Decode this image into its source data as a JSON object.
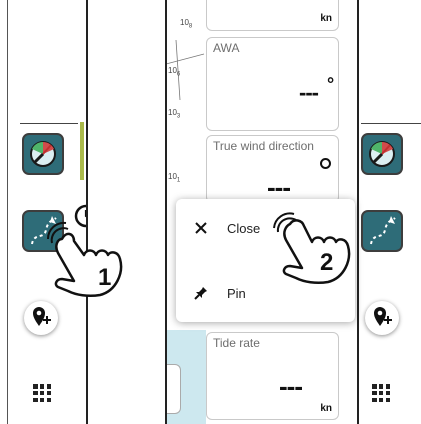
{
  "map_scale": [
    "10",
    "8",
    "10",
    "6",
    "10",
    "3",
    "10",
    "1"
  ],
  "cards": [
    {
      "label": "",
      "value": "",
      "unit": "kn"
    },
    {
      "label": "AWA",
      "value": "---",
      "unit": "°"
    },
    {
      "label": "True wind direction",
      "value": "---",
      "unit": ""
    },
    {
      "label": "Tide rate",
      "value": "---",
      "unit": "kn"
    }
  ],
  "context_menu": {
    "items": [
      {
        "label": "Close",
        "icon": "close-icon"
      },
      {
        "label": "Pin",
        "icon": "pin-icon"
      }
    ]
  },
  "gestures": [
    {
      "step": "1",
      "action": "long-press-timer-icon"
    },
    {
      "step": "2",
      "action": "tap"
    }
  ],
  "colors": {
    "tile": "#2e6c78",
    "tile_accent": "#a9b94a",
    "map_water": "#cde8ef",
    "card_border": "#c9c9c9"
  }
}
